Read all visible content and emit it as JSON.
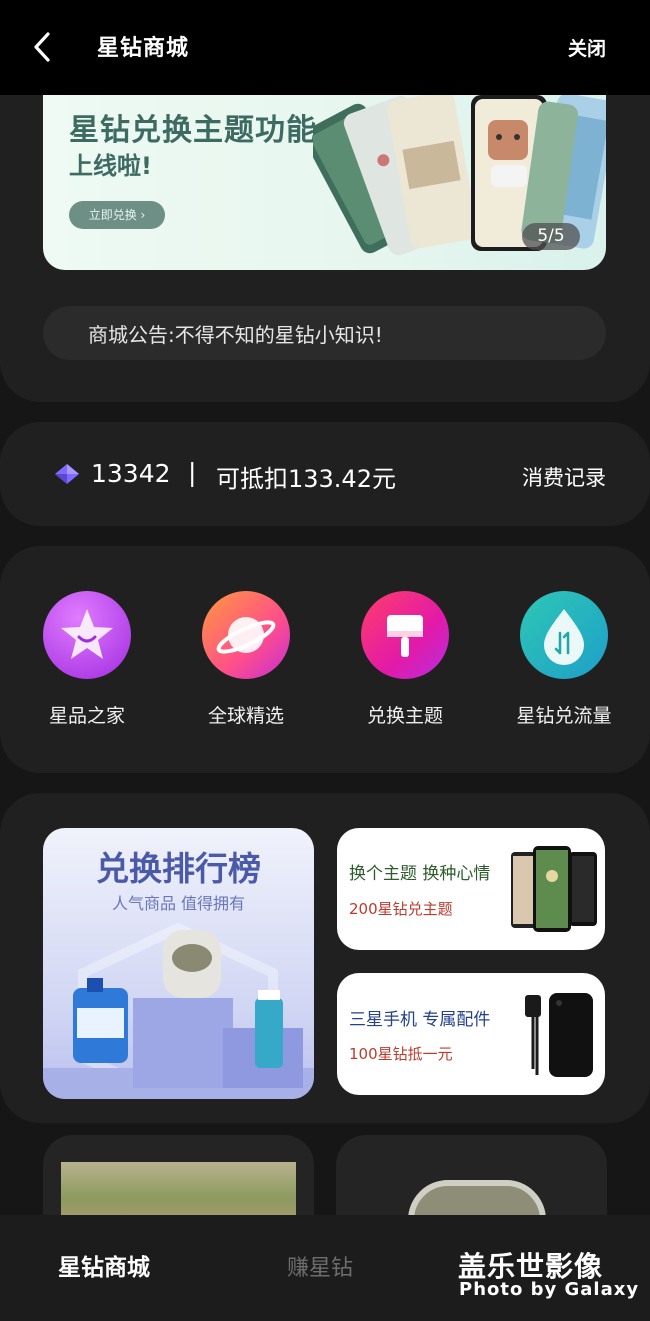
{
  "header": {
    "title": "星钻商城",
    "close_label": "关闭"
  },
  "banner": {
    "line1": "星钻兑换主题功能",
    "line2": "上线啦!",
    "button": "立即兑换 ›",
    "pager": "5/5"
  },
  "notice": {
    "text": "商城公告:不得不知的星钻小知识!"
  },
  "balance": {
    "points": "13342",
    "separator": "|",
    "deduct": "可抵扣133.42元",
    "records_label": "消费记录"
  },
  "categories": [
    {
      "label": "星品之家",
      "icon": "star-icon"
    },
    {
      "label": "全球精选",
      "icon": "planet-icon"
    },
    {
      "label": "兑换主题",
      "icon": "brush-icon"
    },
    {
      "label": "星钻兑流量",
      "icon": "drop-icon"
    }
  ],
  "promo": {
    "rank_title": "兑换排行榜",
    "rank_subtitle": "人气商品 值得拥有",
    "theme_title": "换个主题 换种心情",
    "theme_sub": "200星钻兑主题",
    "acc_title": "三星手机 专属配件",
    "acc_sub": "100星钻抵一元"
  },
  "navbar": {
    "tab1": "星钻商城",
    "tab2": "赚星钻"
  },
  "watermark": {
    "line1": "盖乐世影像",
    "line2": "Photo by Galaxy"
  },
  "colors": {
    "banner_text": "#3d6b62",
    "accent_red": "#c0392b",
    "diamond": "#7f6bff"
  }
}
